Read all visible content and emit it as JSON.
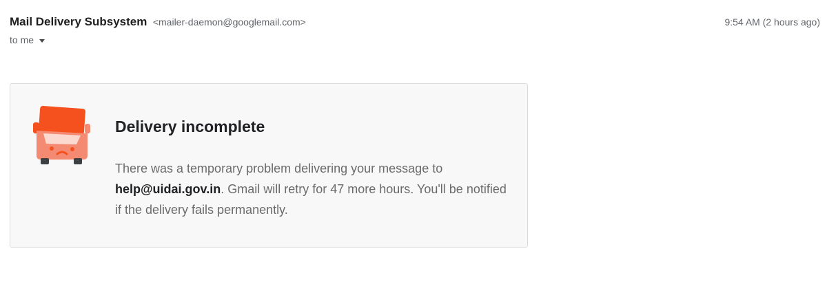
{
  "header": {
    "sender_name": "Mail Delivery Subsystem",
    "sender_email": "<mailer-daemon@googlemail.com>",
    "recipient_label": "to me",
    "timestamp": "9:54 AM (2 hours ago)"
  },
  "card": {
    "icon": "sad-truck-icon",
    "title": "Delivery incomplete",
    "body_before": "There was a temporary problem delivering your message to ",
    "recipient_address": "help@uidai.gov.in",
    "body_after": ". Gmail will retry for 47 more hours. You'll be notified if the delivery fails permanently."
  },
  "colors": {
    "truck_cab": "#f4511e",
    "truck_body": "#f58a72",
    "truck_wheels": "#3c4043",
    "card_background": "#f8f8f8",
    "card_border": "#dadce0"
  }
}
